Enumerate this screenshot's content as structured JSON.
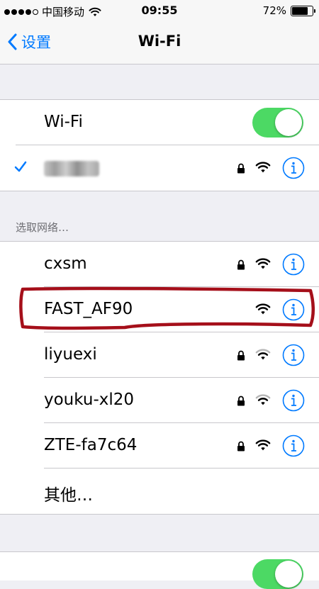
{
  "status_bar": {
    "carrier": "中国移动",
    "time": "09:55",
    "battery_level": "72%"
  },
  "nav": {
    "back_label": "设置",
    "title": "Wi-Fi"
  },
  "wifi_toggle": {
    "label": "Wi-Fi",
    "on": true
  },
  "section_header": "选取网络…",
  "networks": [
    {
      "name": "cxsm",
      "secured": true,
      "signal": "full"
    },
    {
      "name": "FAST_AF90",
      "secured": false,
      "signal": "full"
    },
    {
      "name": "liyuexi",
      "secured": true,
      "signal": "medium"
    },
    {
      "name": "youku-xl20",
      "secured": true,
      "signal": "medium"
    },
    {
      "name": "ZTE-fa7c64",
      "secured": true,
      "signal": "full"
    }
  ],
  "other_label": "其他…",
  "colors": {
    "accent": "#007aff",
    "toggle_on": "#4cd964",
    "annotation": "#a50f1a"
  }
}
